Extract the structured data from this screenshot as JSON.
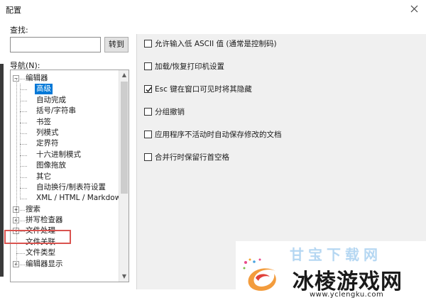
{
  "window": {
    "title": "配置"
  },
  "search": {
    "label": "查找:",
    "value": "",
    "goto_label": "转到"
  },
  "nav": {
    "label": "导航(N):",
    "items": [
      {
        "label": "编辑器",
        "level": 0,
        "expander": "-"
      },
      {
        "label": "高级",
        "level": 1,
        "selected": true
      },
      {
        "label": "自动完成",
        "level": 1
      },
      {
        "label": "括号/字符串",
        "level": 1
      },
      {
        "label": "书签",
        "level": 1
      },
      {
        "label": "列模式",
        "level": 1
      },
      {
        "label": "定界符",
        "level": 1
      },
      {
        "label": "十六进制模式",
        "level": 1
      },
      {
        "label": "图像拖放",
        "level": 1
      },
      {
        "label": "其它",
        "level": 1
      },
      {
        "label": "自动换行/制表符设置",
        "level": 1
      },
      {
        "label": "XML / HTML / Markdow",
        "level": 1
      },
      {
        "label": "搜索",
        "level": 0,
        "expander": "+"
      },
      {
        "label": "拼写检查器",
        "level": 0,
        "expander": "+"
      },
      {
        "label": "文件处理",
        "level": 0,
        "expander": "+"
      },
      {
        "label": "文件关联",
        "level": 0
      },
      {
        "label": "文件类型",
        "level": 0
      },
      {
        "label": "编辑器显示",
        "level": 0,
        "expander": "+"
      }
    ]
  },
  "options": [
    {
      "label": "允许输入低 ASCII 值 (通常是控制码)",
      "checked": false
    },
    {
      "label": "加载/恢复打印机设置",
      "checked": false
    },
    {
      "label": "Esc 键在窗口可见时将其隐藏",
      "checked": true
    },
    {
      "label": "分组撤销",
      "checked": false
    },
    {
      "label": "应用程序不活动时自动保存修改的文档",
      "checked": false
    },
    {
      "label": "合并行时保留行首空格",
      "checked": false
    }
  ],
  "watermark": {
    "brand": "冰棱游戏网",
    "url": "www.yclengku.com",
    "faint_text": "甘宝下载网"
  },
  "colors": {
    "selection": "#0078d7",
    "highlight_box": "#d9534f",
    "panel_bg": "#f0f0f0"
  }
}
